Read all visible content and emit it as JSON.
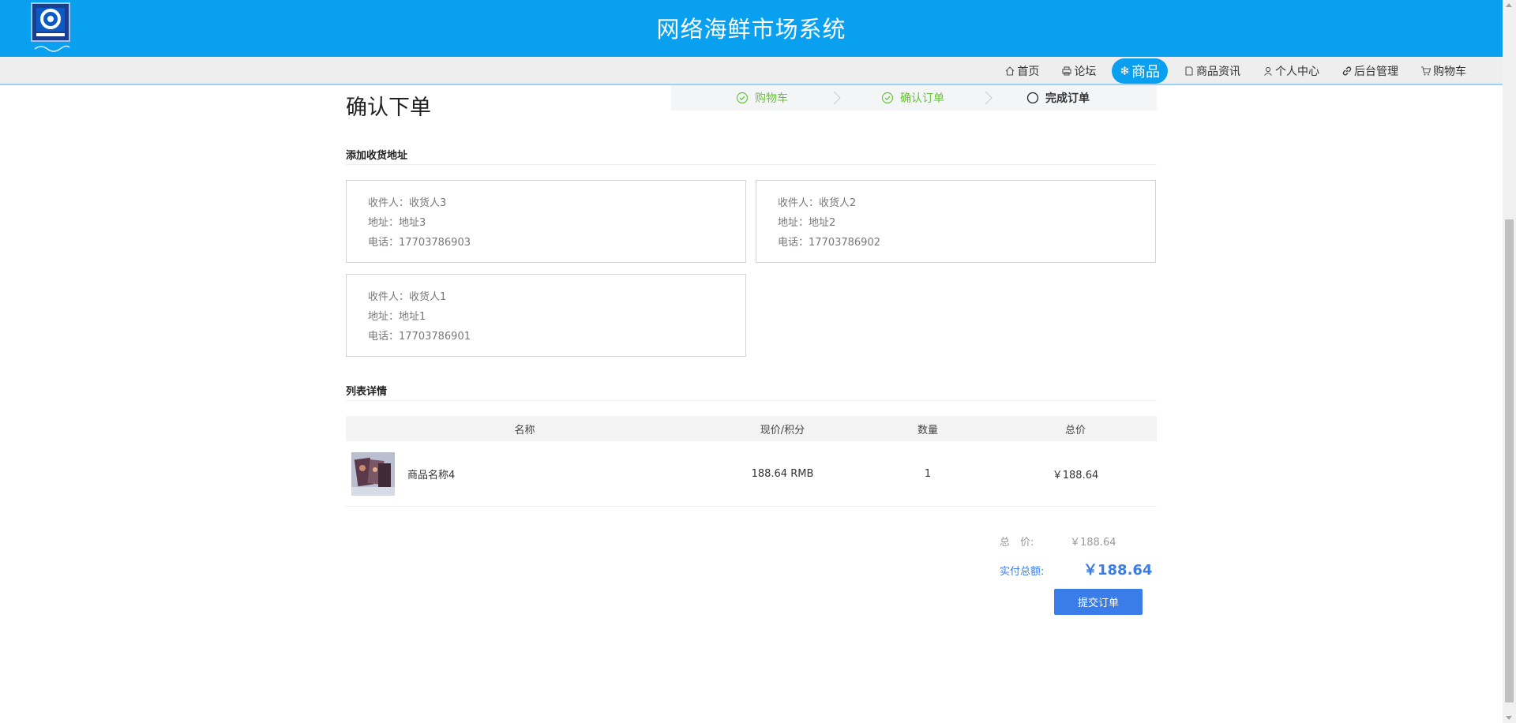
{
  "header": {
    "site_title": "网络海鲜市场系统",
    "brand_color": "#0aa0f0"
  },
  "nav": {
    "items": [
      {
        "label": "首页",
        "icon": "home-icon"
      },
      {
        "label": "论坛",
        "icon": "printer-icon"
      },
      {
        "label": "商品",
        "icon": "snowflake-icon",
        "active": true
      },
      {
        "label": "商品资讯",
        "icon": "document-icon"
      },
      {
        "label": "个人中心",
        "icon": "user-icon"
      },
      {
        "label": "后台管理",
        "icon": "link-icon"
      },
      {
        "label": "购物车",
        "icon": "cart-icon"
      }
    ]
  },
  "page": {
    "heading": "确认下单"
  },
  "steps": [
    {
      "label": "购物车",
      "state": "done"
    },
    {
      "label": "确认订单",
      "state": "done"
    },
    {
      "label": "完成订单",
      "state": "current"
    }
  ],
  "address_section": {
    "title": "添加收货地址",
    "cards": [
      {
        "receiver": "收件人：收货人3",
        "address": "地址：地址3",
        "phone": "电话：17703786903"
      },
      {
        "receiver": "收件人：收货人2",
        "address": "地址：地址2",
        "phone": "电话：17703786902"
      },
      {
        "receiver": "收件人：收货人1",
        "address": "地址：地址1",
        "phone": "电话：17703786901"
      }
    ]
  },
  "list_section": {
    "title": "列表详情",
    "columns": [
      "名称",
      "现价/积分",
      "数量",
      "总价"
    ],
    "rows": [
      {
        "name": "商品名称4",
        "price": "188.64 RMB",
        "qty": "1",
        "total": "￥188.64"
      }
    ]
  },
  "summary": {
    "total_label": "总　价:",
    "total_value": "￥188.64",
    "paid_label": "实付总额:",
    "paid_value": "￥188.64",
    "submit_label": "提交订单",
    "accent_color": "#3a7de8"
  }
}
